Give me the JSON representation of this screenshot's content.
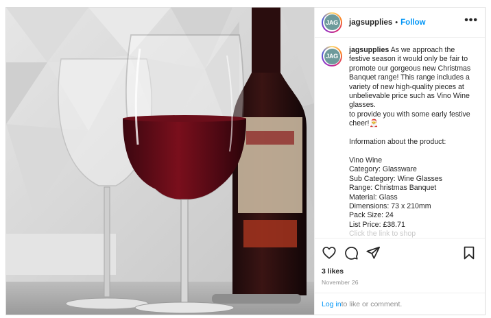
{
  "header": {
    "avatar_text": "JAG",
    "username": "jagsupplies",
    "separator": "•",
    "follow_label": "Follow",
    "more_label": "•••"
  },
  "caption": {
    "username": "jagsupplies",
    "text": " As we approach the festive season it would only be fair to promote our gorgeous new Christmas Banquet range! This range includes a variety of new high-quality pieces at unbelievable price such as Vino Wine glasses.\nto provide you with some early festive cheer!🎅\n\nInformation about the product:\n\nVino Wine\nCategory: Glassware\nSub Category: Wine Glasses\nRange: Christmas Banquet\nMaterial: Glass\nDimensions: 73 x 210mm\nPack Size: 24\nList Price: £38.71\n",
    "truncated_text": "Click the link to shop"
  },
  "actions": {
    "like_icon": "heart-icon",
    "comment_icon": "comment-icon",
    "share_icon": "share-icon",
    "save_icon": "bookmark-icon"
  },
  "likes": "3 likes",
  "date": "November 26",
  "comment_prompt": {
    "login_label": "Log in",
    "rest": " to like or comment."
  },
  "colors": {
    "follow": "#0095f6",
    "text": "#262626",
    "muted": "#8e8e8e",
    "wine": "#5a0b14"
  }
}
